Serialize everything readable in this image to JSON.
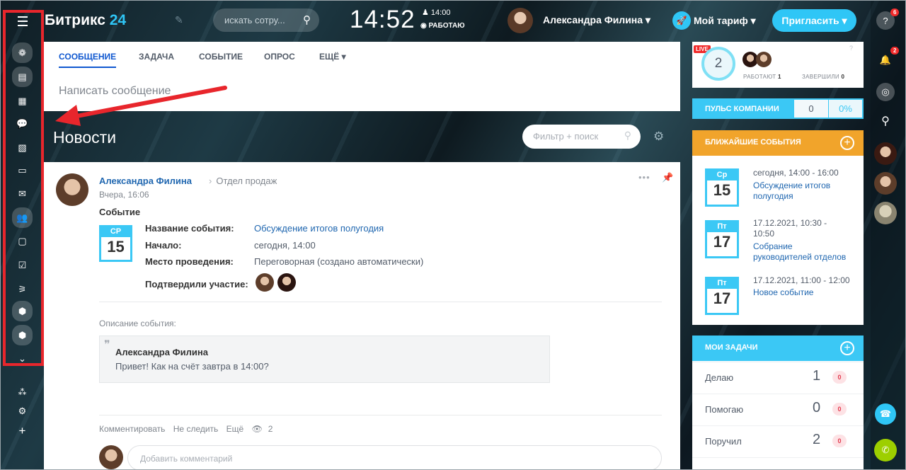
{
  "header": {
    "logo_main": "Битрикс",
    "logo_num": "24",
    "search_placeholder": "искать сотру...",
    "clock": "14:52",
    "alarm": "14:00",
    "work_status": "РАБОТАЮ",
    "user_name": "Александра Филина",
    "tariff_label": "Мой тариф",
    "invite_label": "Пригласить"
  },
  "right_bar": {
    "help_badge": "6",
    "notif_badge": "2"
  },
  "composer": {
    "tabs": [
      "СООБЩЕНИЕ",
      "ЗАДАЧА",
      "СОБЫТИЕ",
      "ОПРОС",
      "ЕЩЁ"
    ],
    "placeholder": "Написать сообщение"
  },
  "feed": {
    "title": "Новости",
    "filter_placeholder": "Фильтр + поиск"
  },
  "post": {
    "author": "Александра Филина",
    "department": "Отдел продаж",
    "time": "Вчера, 16:06",
    "type": "Событие",
    "cal_day": "СР",
    "cal_date": "15",
    "fields": {
      "name_label": "Название события:",
      "name_value": "Обсуждение итогов полугодия",
      "start_label": "Начало:",
      "start_value": "сегодня, 14:00",
      "place_label": "Место проведения:",
      "place_value": "Переговорная (создано автоматически)",
      "confirmed_label": "Подтвердили участие:"
    },
    "desc_label": "Описание события:",
    "quote_author": "Александра Филина",
    "quote_text": "Привет! Как на счёт завтра в 14:00?",
    "actions": {
      "comment": "Комментировать",
      "unfollow": "Не следить",
      "more": "Ещё",
      "views": "2"
    },
    "comment_placeholder": "Добавить комментарий"
  },
  "pulse": {
    "live": "LIVE",
    "count": "2",
    "working_label": "РАБОТАЮТ",
    "working_count": "1",
    "finished_label": "ЗАВЕРШИЛИ",
    "finished_count": "0",
    "bar_title": "ПУЛЬС КОМПАНИИ",
    "bar_value": "0",
    "bar_percent": "0%"
  },
  "events": {
    "title": "БЛИЖАЙШИЕ СОБЫТИЯ",
    "items": [
      {
        "day": "Ср",
        "date": "15",
        "time": "сегодня, 14:00 - 16:00",
        "title_1": "Обсуждение итогов",
        "title_2": "полугодия"
      },
      {
        "day": "Пт",
        "date": "17",
        "time_1": "17.12.2021, 10:30 -",
        "time_2": "10:50",
        "title_1": "Собрание",
        "title_2": "руководителей отделов"
      },
      {
        "day": "Пт",
        "date": "17",
        "time": "17.12.2021, 11:00 - 12:00",
        "title_1": "Новое событие"
      }
    ]
  },
  "tasks": {
    "title": "МОИ ЗАДАЧИ",
    "rows": [
      {
        "label": "Делаю",
        "count": "1",
        "badge": "0"
      },
      {
        "label": "Помогаю",
        "count": "0",
        "badge": "0"
      },
      {
        "label": "Поручил",
        "count": "2",
        "badge": "0"
      }
    ]
  },
  "colors": {
    "accent": "#2fc6f6",
    "events_header": "#f1a42b",
    "highlight_box": "#e8262c",
    "link": "#2067b0"
  }
}
